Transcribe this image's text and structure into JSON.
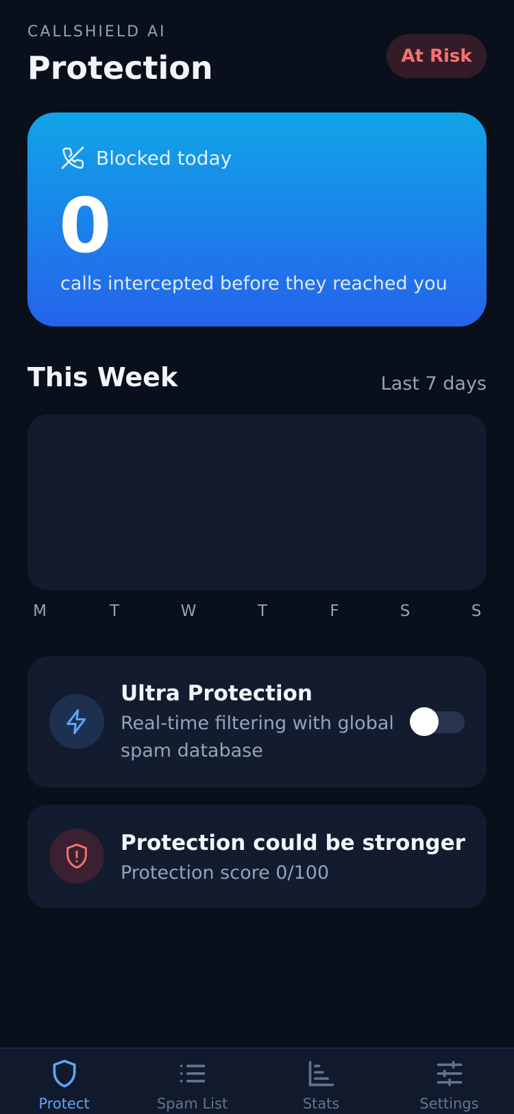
{
  "header": {
    "brand": "CALLSHIELD AI",
    "title": "Protection",
    "status_badge": "At Risk"
  },
  "blocked": {
    "label": "Blocked today",
    "count": "0",
    "subtitle": "calls intercepted before they reached you"
  },
  "week": {
    "title": "This Week",
    "range": "Last 7 days",
    "days": [
      "M",
      "T",
      "W",
      "T",
      "F",
      "S",
      "S"
    ]
  },
  "ultra": {
    "title": "Ultra Protection",
    "description": "Real-time filtering with global spam database",
    "enabled": false
  },
  "score": {
    "title": "Protection could be stronger",
    "description": "Protection score 0/100"
  },
  "nav": {
    "items": [
      {
        "label": "Protect",
        "icon": "shield-icon",
        "active": true
      },
      {
        "label": "Spam List",
        "icon": "list-icon",
        "active": false
      },
      {
        "label": "Stats",
        "icon": "bar-chart-icon",
        "active": false
      },
      {
        "label": "Settings",
        "icon": "sliders-icon",
        "active": false
      }
    ]
  },
  "colors": {
    "background": "#0a0f1c",
    "card": "#131c2e",
    "accent": "#60a5fa",
    "danger": "#f87171",
    "gradient_top": "#10a4e8",
    "gradient_bottom": "#2563eb"
  }
}
